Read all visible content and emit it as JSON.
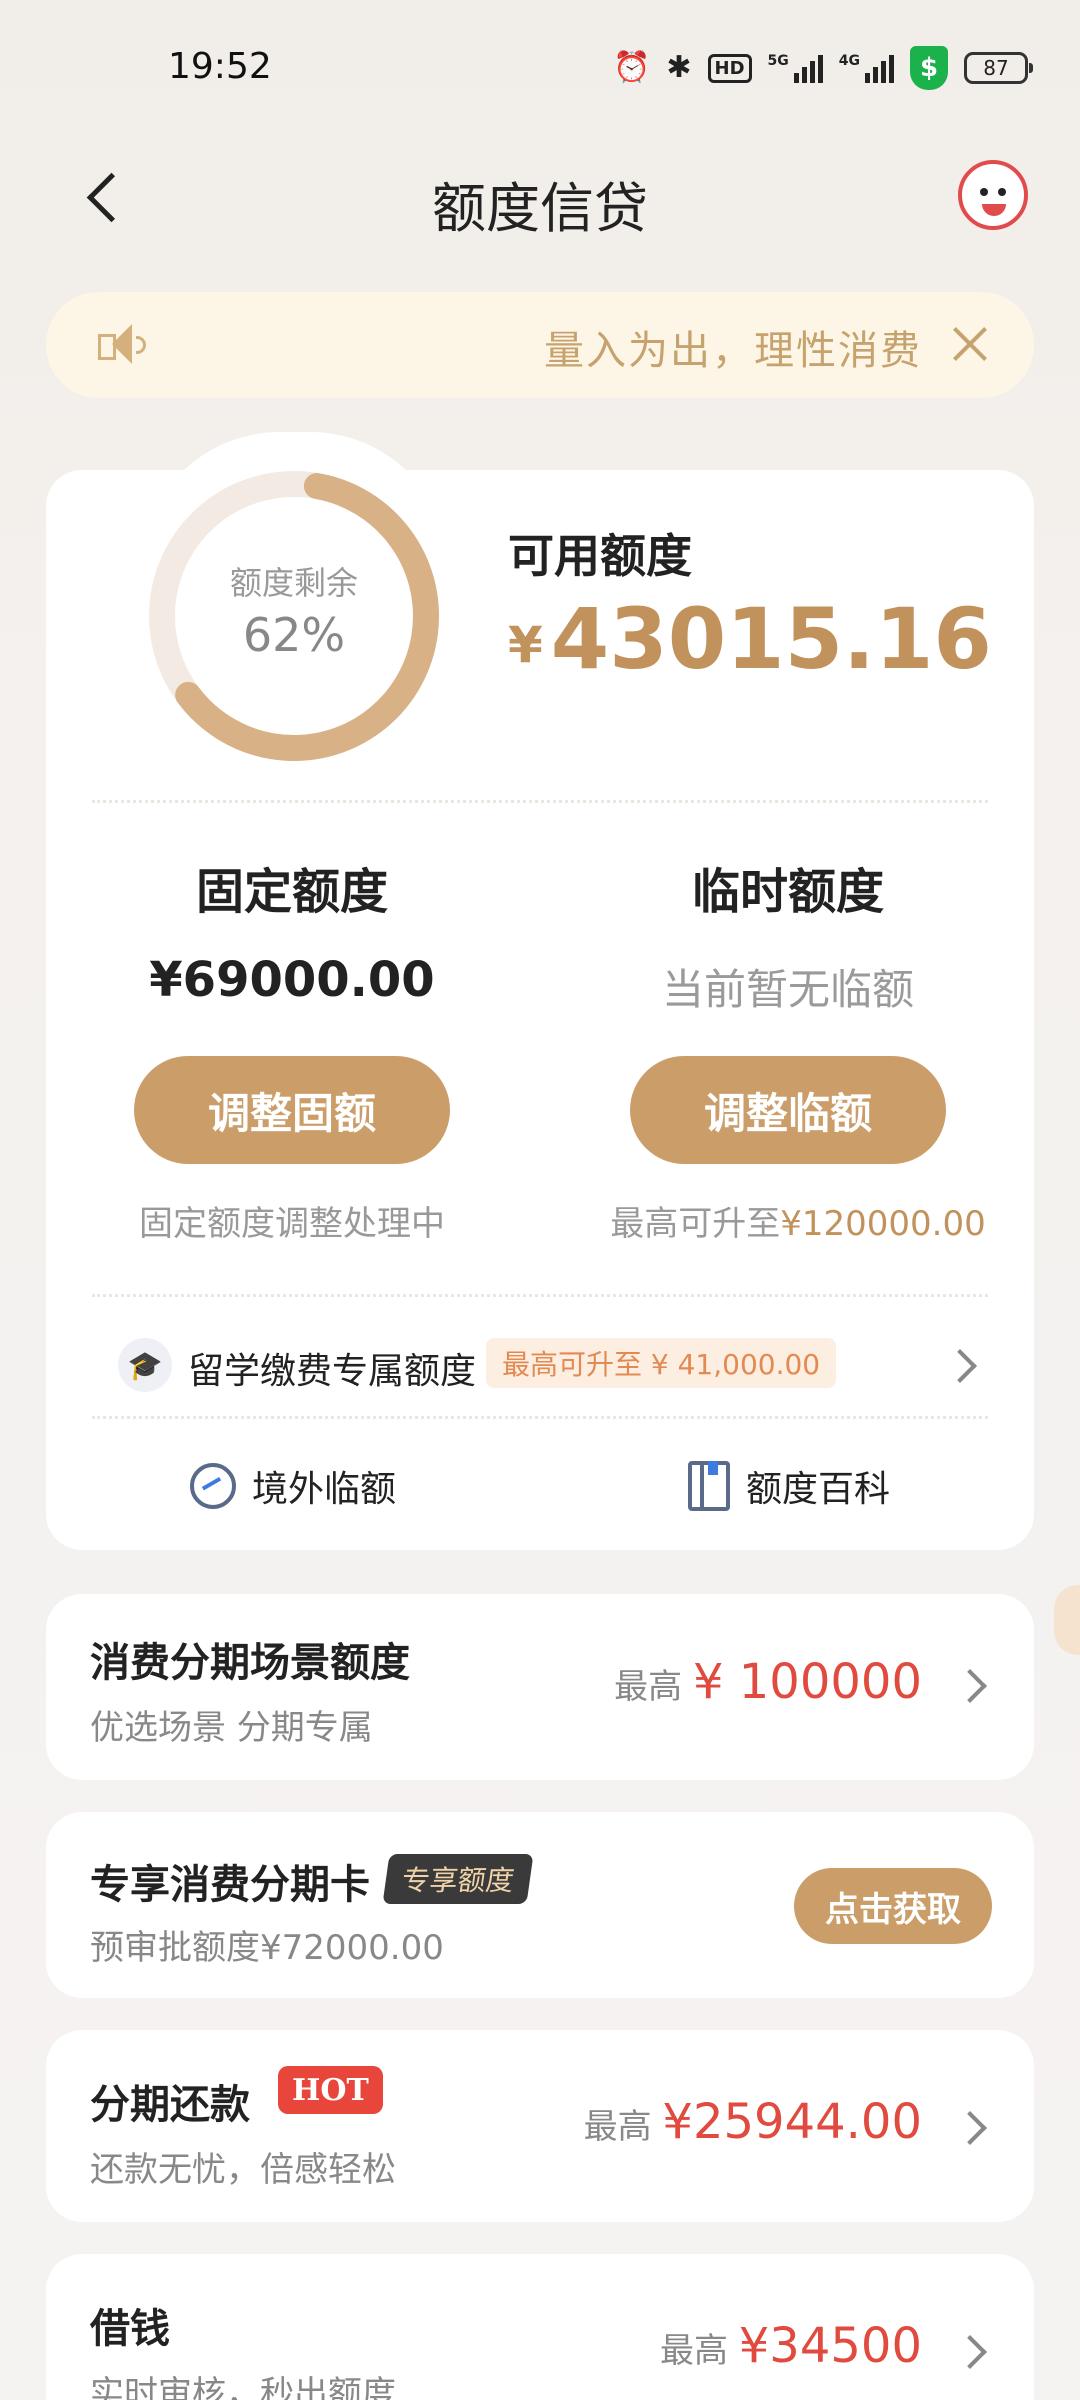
{
  "status_bar": {
    "time": "19:52",
    "hd_label": "HD",
    "sig5g_label": "5G",
    "sig4g_label": "4G",
    "battery": "87",
    "icons": [
      "alarm-icon",
      "bluetooth-icon",
      "hd-voice-icon",
      "signal-5g-icon",
      "signal-4g-icon",
      "security-shield-icon",
      "battery-icon"
    ]
  },
  "nav": {
    "title": "额度信贷"
  },
  "notice": {
    "text": "量入为出，理性消费"
  },
  "credit": {
    "remaining_label": "额度剩余",
    "remaining_pct_text": "62%",
    "remaining_fraction": 0.62,
    "available_label": "可用额度",
    "currency": "¥",
    "available_value": "43015.16"
  },
  "fixed": {
    "title": "固定额度",
    "amount": "¥69000.00",
    "button": "调整固额",
    "note": "固定额度调整处理中"
  },
  "temp": {
    "title": "临时额度",
    "empty": "当前暂无临额",
    "button": "调整临额",
    "note_prefix": "最高可升至",
    "note_value": "¥120000.00"
  },
  "study": {
    "text": "留学缴费专属额度",
    "tag": "最高可升至 ¥ 41,000.00"
  },
  "links": {
    "overseas": "境外临额",
    "wiki": "额度百科"
  },
  "cards": {
    "installment_scene": {
      "title": "消费分期场景额度",
      "sub": "优选场景 分期专属",
      "prefix": "最高",
      "value": "¥ 100000"
    },
    "exclusive_card": {
      "title": "专享消费分期卡",
      "badge": "专享额度",
      "sub": "预审批额度¥72000.00",
      "button": "点击获取"
    },
    "installment_repay": {
      "title": "分期还款",
      "badge": "HOT",
      "sub": "还款无忧，倍感轻松",
      "prefix": "最高",
      "value": "¥25944.00"
    },
    "borrow": {
      "title": "借钱",
      "sub": "实时审核，秒出额度",
      "prefix": "最高",
      "value": "¥34500"
    }
  },
  "colors": {
    "accent": "#cb9d68",
    "gold_text": "#c2925c",
    "red": "#e04a3f",
    "notice_bg": "#fdf6e6"
  }
}
